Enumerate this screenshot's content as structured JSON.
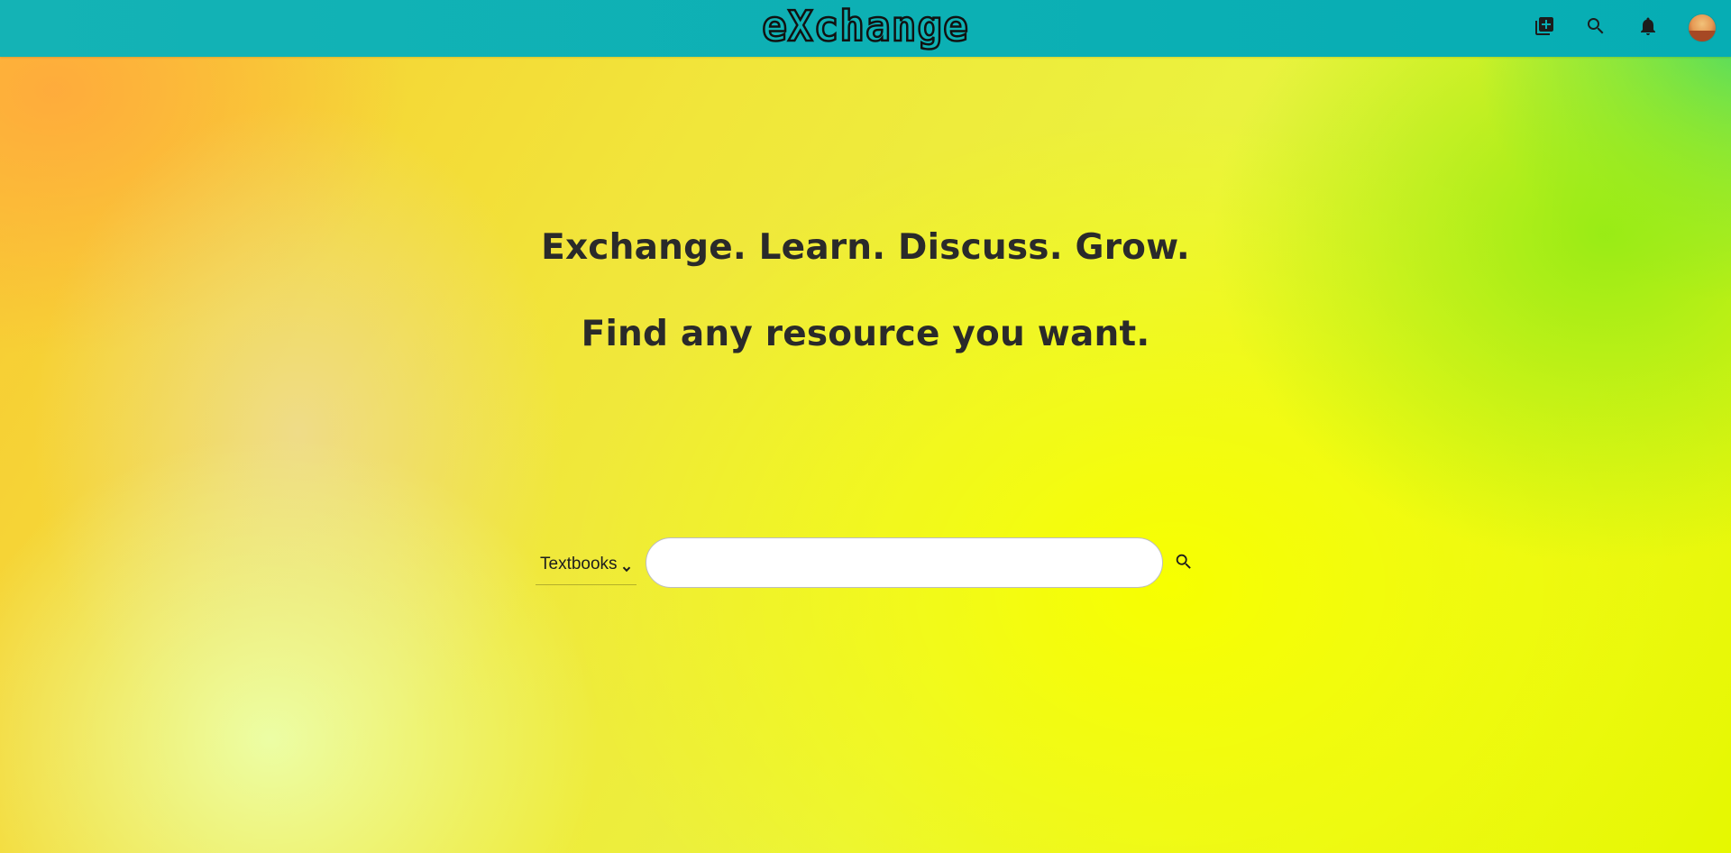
{
  "header": {
    "logo_text": "eXchange",
    "icons": [
      "add-library-icon",
      "search-icon",
      "notifications-icon",
      "avatar"
    ]
  },
  "hero": {
    "line1": "Exchange. Learn. Discuss. Grow.",
    "line2": "Find any resource you want."
  },
  "search": {
    "category_selected": "Textbooks",
    "input_value": "",
    "placeholder": ""
  },
  "colors": {
    "header_bg": "#0fb1b3",
    "text_dark": "#2a2a2a"
  }
}
